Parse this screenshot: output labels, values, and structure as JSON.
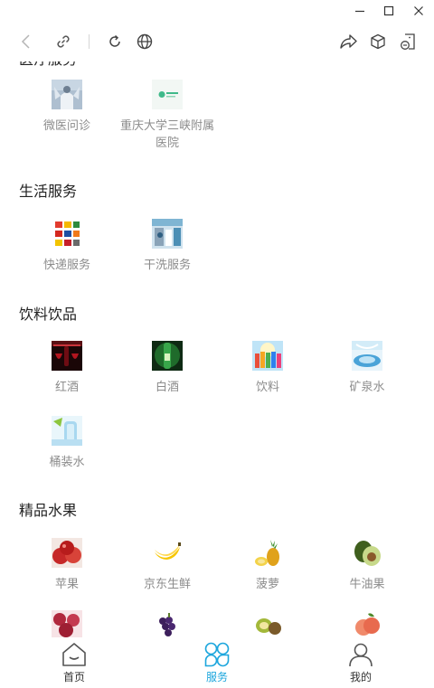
{
  "window": {
    "min_icon": "minimize-icon",
    "max_icon": "maximize-icon",
    "close_icon": "close-icon"
  },
  "toolbar": {
    "left_icons": [
      "back-icon",
      "link-icon",
      "refresh-icon",
      "globe-icon"
    ],
    "right_icons": [
      "share-icon",
      "cube-icon",
      "mini-program-icon"
    ]
  },
  "sections": {
    "medical": {
      "title": "医疗服务",
      "items": [
        {
          "label": "微医问诊"
        },
        {
          "label": "重庆大学三峡附属医院"
        }
      ]
    },
    "life": {
      "title": "生活服务",
      "items": [
        {
          "label": "快递服务"
        },
        {
          "label": "干洗服务"
        }
      ]
    },
    "drinks": {
      "title": "饮料饮品",
      "items": [
        {
          "label": "红酒"
        },
        {
          "label": "白酒"
        },
        {
          "label": "饮料"
        },
        {
          "label": "矿泉水"
        },
        {
          "label": "桶装水"
        }
      ]
    },
    "fruit": {
      "title": "精品水果",
      "items": [
        {
          "label": "苹果"
        },
        {
          "label": "京东生鲜"
        },
        {
          "label": "菠萝"
        },
        {
          "label": "牛油果"
        }
      ]
    }
  },
  "nav": {
    "home": {
      "label": "首页"
    },
    "service": {
      "label": "服务"
    },
    "mine": {
      "label": "我的"
    }
  },
  "colors": {
    "accent": "#1ca6dd",
    "label": "#8c8c8c",
    "title": "#222222"
  }
}
